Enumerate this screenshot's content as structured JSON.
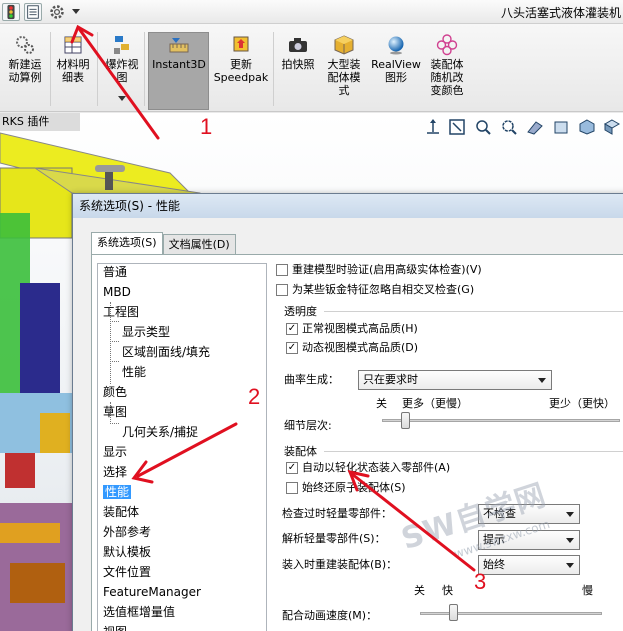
{
  "window": {
    "title": "八头活塞式液体灌装机"
  },
  "quick_access": {
    "icons": [
      "traffic-light-icon",
      "property-manager-icon",
      "gear-icon",
      "dropdown-icon"
    ]
  },
  "ribbon": {
    "buttons": [
      {
        "id": "new-motion",
        "label": "新建运动算例",
        "lines": [
          "新建运",
          "动算例"
        ]
      },
      {
        "id": "bom",
        "label": "材料明细表",
        "lines": [
          "材料明",
          "细表"
        ]
      },
      {
        "id": "exploded",
        "label": "爆炸视图",
        "lines": [
          "爆炸视",
          "图"
        ]
      },
      {
        "id": "instant3d",
        "label": "Instant3D",
        "lines": [
          "Instant3D"
        ]
      },
      {
        "id": "speedpak",
        "label": "更新Speedpak",
        "lines": [
          "更新",
          "Speedpak"
        ]
      },
      {
        "id": "snapshot",
        "label": "拍快照",
        "lines": [
          "拍快照"
        ]
      },
      {
        "id": "large-asm",
        "label": "大型装配体模式",
        "lines": [
          "大型装",
          "配体模",
          "式"
        ]
      },
      {
        "id": "realview",
        "label": "RealView图形",
        "lines": [
          "RealView",
          "图形"
        ]
      },
      {
        "id": "asm-color",
        "label": "装配体随机改变颜色",
        "lines": [
          "装配体",
          "随机改",
          "变颜色"
        ]
      }
    ]
  },
  "tabstrip": {
    "label": "RKS 插件"
  },
  "dialog": {
    "title": "系统选项(S) - 性能",
    "tabs": [
      "系统选项(S)",
      "文档属性(D)"
    ],
    "tree": [
      {
        "label": "普通",
        "sub": false
      },
      {
        "label": "MBD",
        "sub": false
      },
      {
        "label": "工程图",
        "sub": false
      },
      {
        "label": "显示类型",
        "sub": true
      },
      {
        "label": "区域剖面线/填充",
        "sub": true
      },
      {
        "label": "性能",
        "sub": true
      },
      {
        "label": "颜色",
        "sub": false
      },
      {
        "label": "草图",
        "sub": false
      },
      {
        "label": "几何关系/捕捉",
        "sub": true
      },
      {
        "label": "显示",
        "sub": false
      },
      {
        "label": "选择",
        "sub": false
      },
      {
        "label": "性能",
        "sub": false,
        "selected": true
      },
      {
        "label": "装配体",
        "sub": false
      },
      {
        "label": "外部参考",
        "sub": false
      },
      {
        "label": "默认模板",
        "sub": false
      },
      {
        "label": "文件位置",
        "sub": false
      },
      {
        "label": "FeatureManager",
        "sub": false
      },
      {
        "label": "选值框增量值",
        "sub": false
      },
      {
        "label": "视图",
        "sub": false
      }
    ],
    "options": {
      "verify_rebuild": {
        "label": "重建模型时验证(启用高级实体检查)(V)",
        "checked": false
      },
      "ignore_sheetmetal": {
        "label": "为某些钣金特征忽略自相交叉检查(G)",
        "checked": false
      },
      "transparency_group": "透明度",
      "normal_view_hq": {
        "label": "正常视图模式高品质(H)",
        "checked": true
      },
      "dynamic_view_hq": {
        "label": "动态视图模式高品质(D)",
        "checked": true
      },
      "curvature_label": "曲率生成：",
      "curvature_value": "只在要求时",
      "detail_label": "细节层次:",
      "detail_off": "关",
      "detail_more": "更多（更慢）",
      "detail_less": "更少（更快）",
      "assembly_group": "装配体",
      "auto_lightweight": {
        "label": "自动以轻化状态装入零部件(A)",
        "checked": true
      },
      "always_resolve": {
        "label": "始终还原子装配体(S)",
        "checked": false
      },
      "check_outdated_label": "检查过时轻量零部件：",
      "check_outdated_value": "不检查",
      "resolve_lw_label": "解析轻量零部件(S)：",
      "resolve_lw_value": "提示",
      "rebuild_on_load_label": "装入时重建装配体(B)：",
      "rebuild_on_load_value": "始终",
      "anim_off": "关",
      "anim_fast": "快",
      "anim_slow": "慢",
      "anim_speed_label": "配合动画速度(M)："
    }
  },
  "watermark": {
    "text": "SW自学网",
    "url": "www.swzxw.com"
  },
  "callouts": [
    "1",
    "2",
    "3"
  ],
  "colors": {
    "arrow": "#e01020",
    "selection": "#3399ff"
  }
}
